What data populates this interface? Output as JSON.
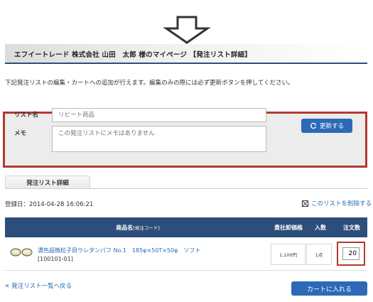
{
  "header": {
    "title": "エフイートレード 株式会社 山田　太郎 様のマイページ 【発注リスト詳細】"
  },
  "description": "下記発注リストの編集・カートへの追加が行えます。編集のみの際には必ず更新ボタンを押してください。",
  "edit": {
    "name_label": "リスト名",
    "name_placeholder": "リピート商品",
    "memo_label": "メモ",
    "memo_placeholder": "この発注リストにメモはありません",
    "update_label": "更新する"
  },
  "tab": {
    "label": "発注リスト詳細"
  },
  "registered": "登録日：2014-04-28 16:06:21",
  "delete_label": "このリストを削除する",
  "table": {
    "headers": {
      "name": "商品名",
      "code": "[発注コード]",
      "price": "貴社卸価格",
      "pack": "入数",
      "qty": "注文数"
    },
    "rows": [
      {
        "name": "濃色超微粒子目ウレタンパフ No.1　185φ×50T×50φ　ソフト",
        "code": "[100101-01]",
        "price": "1,100円",
        "pack": "1点",
        "qty": "20"
      }
    ]
  },
  "back_label": "発注リスト一覧へ戻る",
  "cart_label": "カートに入れる",
  "colors": {
    "accent": "#2c6ab7",
    "header_bar": "#2c4e7a",
    "highlight": "#b23a2e"
  }
}
